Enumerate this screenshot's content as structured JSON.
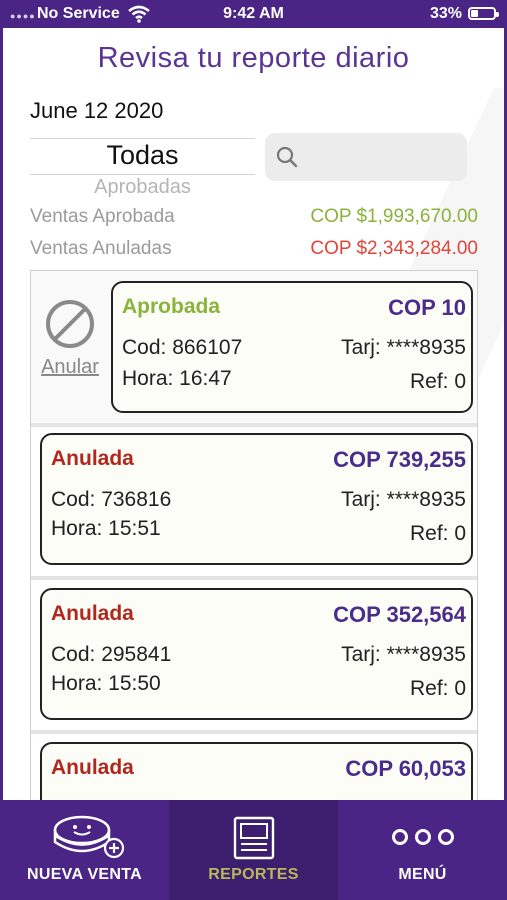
{
  "status_bar": {
    "carrier": "No Service",
    "time": "9:42 AM",
    "battery_pct": "33%",
    "battery_level": 0.33,
    "wifi_icon": "wifi-icon"
  },
  "header": {
    "title": "Revisa tu reporte diario",
    "date": "June 12 2020"
  },
  "filter": {
    "selected": "Todas",
    "next_option": "Aprobadas"
  },
  "search": {
    "placeholder": ""
  },
  "summary": {
    "approved_label": "Ventas Aprobada",
    "approved_value": "COP $1,993,670.00",
    "voided_label": "Ventas Anuladas",
    "voided_value": "COP $2,343,284.00"
  },
  "colors": {
    "brand": "#4a2585",
    "approved": "#8ab33c",
    "voided": "#e0453b",
    "status_voided": "#b3261e",
    "amount": "#4a2c8a"
  },
  "void_action": {
    "label": "Anular",
    "icon": "prohibited-icon"
  },
  "transactions": [
    {
      "status": "Aprobada",
      "amount": "COP 10",
      "cod": "Cod: 866107",
      "card": "Tarj: ****8935",
      "time": "Hora: 16:47",
      "ref": "Ref: 0"
    },
    {
      "status": "Anulada",
      "amount": "COP 739,255",
      "cod": "Cod: 736816",
      "card": "Tarj: ****8935",
      "time": "Hora: 15:51",
      "ref": "Ref: 0"
    },
    {
      "status": "Anulada",
      "amount": "COP 352,564",
      "cod": "Cod: 295841",
      "card": "Tarj: ****8935",
      "time": "Hora: 15:50",
      "ref": "Ref: 0"
    },
    {
      "status": "Anulada",
      "amount": "COP 60,053"
    }
  ],
  "tabbar": {
    "tabs": [
      {
        "label": "NUEVA VENTA",
        "icon": "coin-plus-icon"
      },
      {
        "label": "REPORTES",
        "icon": "report-icon"
      },
      {
        "label": "MENÚ",
        "icon": "more-dots-icon"
      }
    ],
    "active": "REPORTES"
  }
}
